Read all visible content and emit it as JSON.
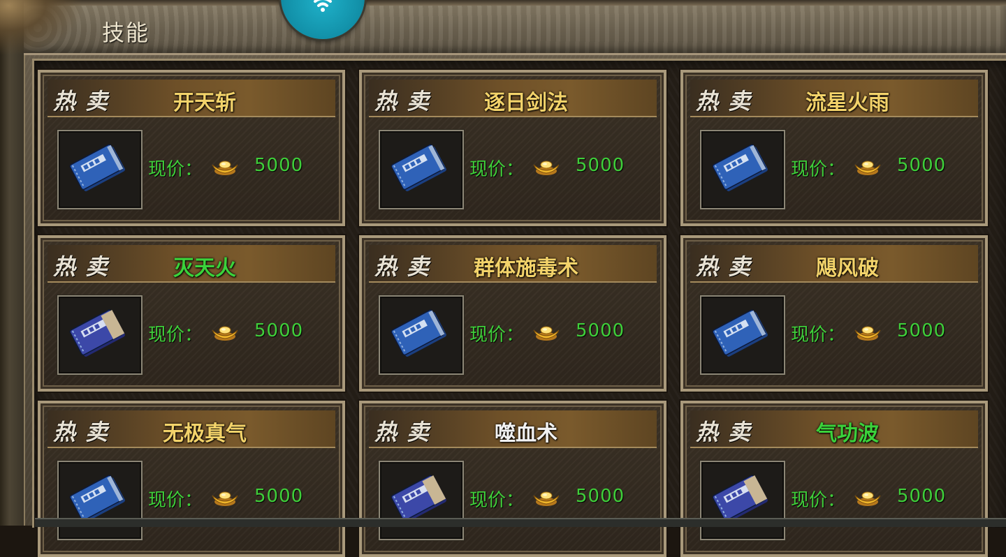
{
  "window": {
    "title": "技能"
  },
  "colors": {
    "name_yellow": "#f3d36a",
    "name_green": "#3bd23b",
    "name_white": "#f2f2f2",
    "price_green": "#3fcf3a",
    "badge_teal": "#1aa3bb"
  },
  "icons": {
    "badge": "wifi-icon",
    "currency": "gold-ingot-icon",
    "item": "skill-book-icon"
  },
  "cards": [
    {
      "tag": "热卖",
      "name": "开天斩",
      "name_color": "#f3d36a",
      "price_label": "现价：",
      "price": "5000",
      "book": "blue"
    },
    {
      "tag": "热卖",
      "name": "逐日剑法",
      "name_color": "#f3d36a",
      "price_label": "现价：",
      "price": "5000",
      "book": "blue"
    },
    {
      "tag": "热卖",
      "name": "流星火雨",
      "name_color": "#f3d36a",
      "price_label": "现价：",
      "price": "5000",
      "book": "blue"
    },
    {
      "tag": "热卖",
      "name": "灭天火",
      "name_color": "#3bd23b",
      "price_label": "现价：",
      "price": "5000",
      "book": "purple"
    },
    {
      "tag": "热卖",
      "name": "群体施毒术",
      "name_color": "#f3d36a",
      "price_label": "现价：",
      "price": "5000",
      "book": "blue"
    },
    {
      "tag": "热卖",
      "name": "飓风破",
      "name_color": "#f3d36a",
      "price_label": "现价：",
      "price": "5000",
      "book": "blue"
    },
    {
      "tag": "热卖",
      "name": "无极真气",
      "name_color": "#f3d36a",
      "price_label": "现价：",
      "price": "5000",
      "book": "blue"
    },
    {
      "tag": "热卖",
      "name": "噬血术",
      "name_color": "#f2f2f2",
      "price_label": "现价：",
      "price": "5000",
      "book": "purple"
    },
    {
      "tag": "热卖",
      "name": "气功波",
      "name_color": "#3bd23b",
      "price_label": "现价：",
      "price": "5000",
      "book": "purple"
    }
  ]
}
